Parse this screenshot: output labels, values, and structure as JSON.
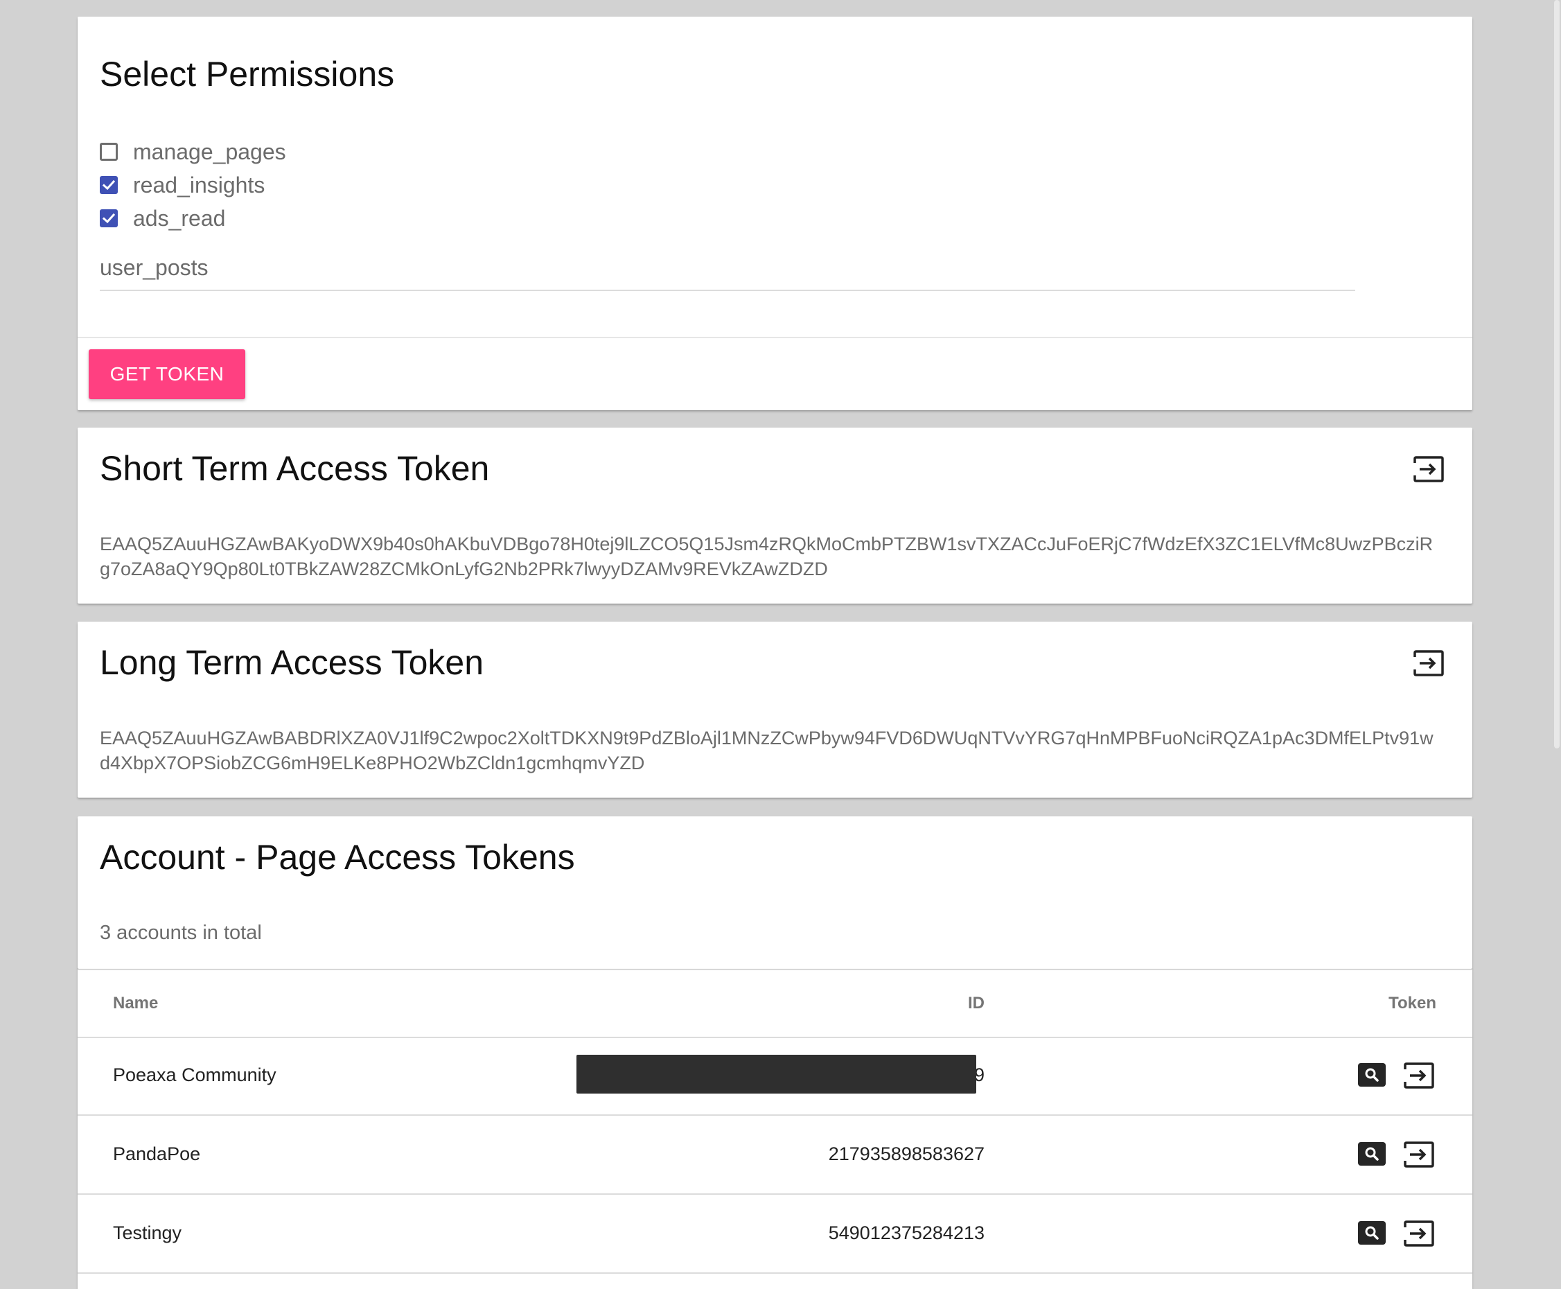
{
  "permissions": {
    "title": "Select Permissions",
    "options": [
      {
        "label": "manage_pages",
        "checked": false
      },
      {
        "label": "read_insights",
        "checked": true
      },
      {
        "label": "ads_read",
        "checked": true
      }
    ],
    "extra_input_value": "user_posts",
    "get_token_label": "GET TOKEN"
  },
  "short_token": {
    "title": "Short Term Access Token",
    "value": "EAAQ5ZAuuHGZAwBAKyoDWX9b40s0hAKbuVDBgo78H0tej9lLZCO5Q15Jsm4zRQkMoCmbPTZBW1svTXZACcJuFoERjC7fWdzEfX3ZC1ELVfMc8UwzPBcziRg7oZA8aQY9Qp80Lt0TBkZAW28ZCMkOnLyfG2Nb2PRk7lwyyDZAMv9REVkZAwZDZD",
    "copy_icon": "copy-to-clipboard-icon"
  },
  "long_token": {
    "title": "Long Term Access Token",
    "value": "EAAQ5ZAuuHGZAwBABDRlXZA0VJ1lf9C2wpoc2XoltTDKXN9t9PdZBloAjl1MNzZCwPbyw94FVD6DWUqNTVvYRG7qHnMPBFuoNciRQZA1pAc3DMfELPtv91wd4XbpX7OPSiobZCG6mH9ELKe8PHO2WbZCldn1gcmhqmvYZD",
    "copy_icon": "copy-to-clipboard-icon"
  },
  "accounts": {
    "title": "Account - Page Access Tokens",
    "count_text": "3 accounts in total",
    "columns": {
      "name": "Name",
      "id": "ID",
      "token": "Token"
    },
    "rows": [
      {
        "name": "Poeaxa Community",
        "id": "9",
        "redacted": true
      },
      {
        "name": "PandaPoe",
        "id": "217935898583627",
        "redacted": false
      },
      {
        "name": "Testingy",
        "id": "549012375284213",
        "redacted": false
      }
    ]
  },
  "colors": {
    "background": "#d2d2d2",
    "checkbox_checked": "#3f51b5",
    "primary_button": "#ff4081",
    "icon_dark": "#262626"
  }
}
